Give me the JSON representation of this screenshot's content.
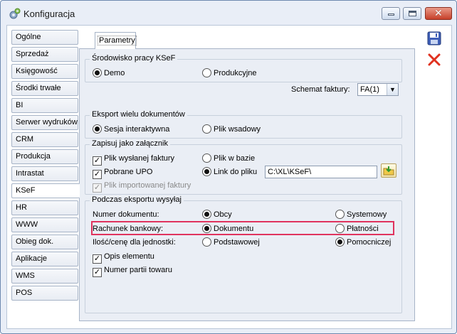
{
  "window": {
    "title": "Konfiguracja"
  },
  "sidebar": {
    "tabs": [
      {
        "label": "Ogólne"
      },
      {
        "label": "Sprzedaż"
      },
      {
        "label": "Księgowość"
      },
      {
        "label": "Środki trwałe"
      },
      {
        "label": "BI"
      },
      {
        "label": "Serwer wydruków"
      },
      {
        "label": "CRM"
      },
      {
        "label": "Produkcja"
      },
      {
        "label": "Intrastat"
      },
      {
        "label": "KSeF"
      },
      {
        "label": "HR"
      },
      {
        "label": "WWW"
      },
      {
        "label": "Obieg dok."
      },
      {
        "label": "Aplikacje"
      },
      {
        "label": "WMS"
      },
      {
        "label": "POS"
      }
    ],
    "active": "KSeF"
  },
  "tabs": {
    "parametry": "Parametry"
  },
  "srodowisko": {
    "title": "Środowisko pracy KSeF",
    "demo": "Demo",
    "produkcyjne": "Produkcyjne",
    "selected": "Demo"
  },
  "schemat": {
    "label": "Schemat faktury:",
    "value": "FA(1)"
  },
  "eksport": {
    "title": "Eksport wielu dokumentów",
    "sesja": "Sesja interaktywna",
    "plik": "Plik wsadowy",
    "selected": "Sesja interaktywna"
  },
  "zalacznik": {
    "title": "Zapisuj jako załącznik",
    "plik_wyslanej": "Plik wysłanej faktury",
    "pobrane_upo": "Pobrane UPO",
    "plik_importowanej": "Plik importowanej faktury",
    "plik_w_bazie": "Plik w bazie",
    "link_do_pliku": "Link do pliku",
    "path": "C:\\XL\\KSeF\\"
  },
  "podczas": {
    "title": "Podczas eksportu wysyłaj",
    "numer_label": "Numer dokumentu:",
    "numer_obcy": "Obcy",
    "numer_systemowy": "Systemowy",
    "rachunek_label": "Rachunek bankowy:",
    "rachunek_dokumentu": "Dokumentu",
    "rachunek_platnosci": "Płatności",
    "ilosc_label": "Ilość/cenę dla jednostki:",
    "ilosc_podstawowej": "Podstawowej",
    "ilosc_pomocniczej": "Pomocniczej",
    "opis_elementu": "Opis elementu",
    "numer_partii": "Numer partii towaru"
  }
}
